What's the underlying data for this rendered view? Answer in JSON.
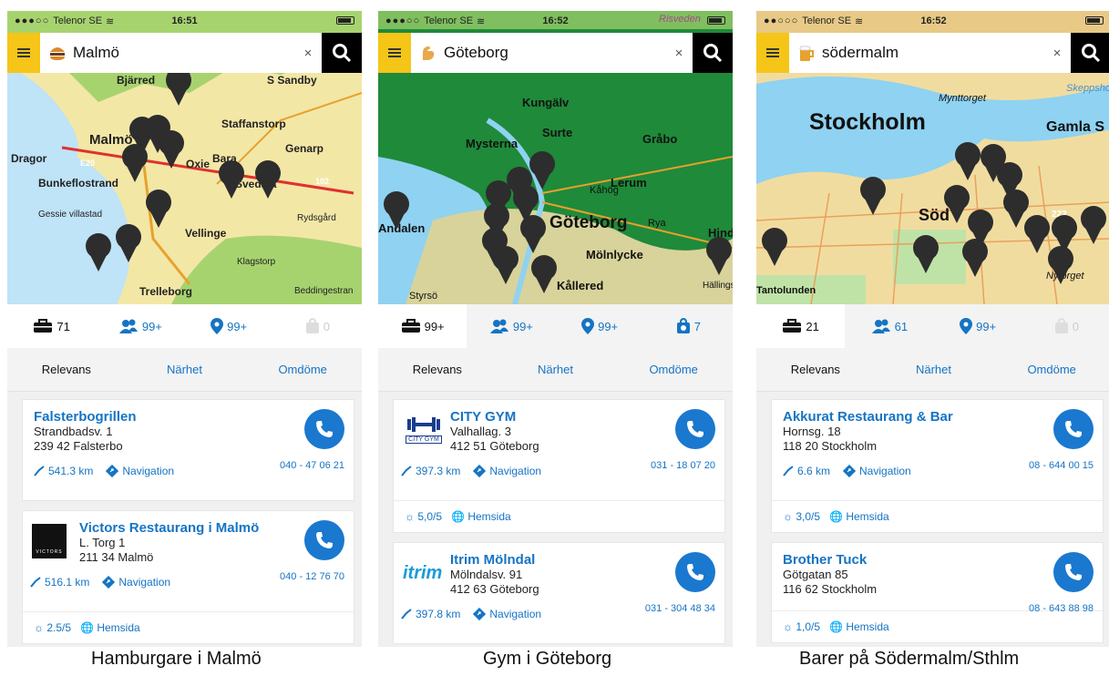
{
  "colors": {
    "accent": "#1574c4",
    "menu_yellow": "#f5c518",
    "call_blue": "#1a78cf"
  },
  "screens": [
    {
      "status": {
        "carrier": "Telenor SE",
        "time": "16:51"
      },
      "search": {
        "category_icon": "burger-icon",
        "query": "Malmö",
        "clear": "×"
      },
      "map": {
        "labels": [
          "Bjärred",
          "S Sandby",
          "Staffanstorp",
          "Malmö",
          "Genarp",
          "Dragor",
          "E20",
          "Bara",
          "Bunkeflostrand",
          "Oxie",
          "Svedala",
          "Gessie villastad",
          "Vellinge",
          "Rydsgård",
          "Klagstorp",
          "Trelleborg",
          "Beddingestran",
          "102"
        ]
      },
      "tabs": [
        "71",
        "99+",
        "99+",
        "0"
      ],
      "sort": [
        "Relevans",
        "Närhet",
        "Omdöme"
      ],
      "cards": [
        {
          "name": "Falsterbogrillen",
          "street": "Strandbadsv. 1",
          "city": "239 42 Falsterbo",
          "phone": "040 - 47 06 21",
          "distance": "541.3 km",
          "nav": "Navigation"
        },
        {
          "name": "Victors Restaurang i Malmö",
          "street": "L. Torg 1",
          "city": "211 34 Malmö",
          "phone": "040 - 12 76 70",
          "distance": "516.1 km",
          "nav": "Navigation",
          "logo": "VICTORS",
          "rating": "2.5/5",
          "web": "Hemsida"
        }
      ],
      "caption": "Hamburgare i Malmö"
    },
    {
      "status": {
        "carrier": "Telenor SE",
        "time": "16:52"
      },
      "search": {
        "category_icon": "flex-arm-icon",
        "query": "Göteborg",
        "clear": "×"
      },
      "map": {
        "labels": [
          "Kungälv",
          "Surte",
          "Mysterna",
          "Gråbo",
          "Lerum",
          "Kåhög",
          "Göteborg",
          "Rya",
          "Mölnlycke",
          "Hind",
          "Kållered",
          "Styrsö",
          "Hällings",
          "Andalen",
          "Risveden"
        ]
      },
      "tabs": [
        "99+",
        "99+",
        "99+",
        "7"
      ],
      "sort": [
        "Relevans",
        "Närhet",
        "Omdöme"
      ],
      "cards": [
        {
          "name": "CITY GYM",
          "street": "Valhallag. 3",
          "city": "412 51 Göteborg",
          "phone": "031 - 18 07 20",
          "distance": "397.3 km",
          "nav": "Navigation",
          "logo": "CITY GYM",
          "rating": "5,0/5",
          "web": "Hemsida"
        },
        {
          "name": "Itrim Mölndal",
          "street": "Mölndalsv. 91",
          "city": "412 63 Göteborg",
          "phone": "031 - 304 48 34",
          "distance": "397.8 km",
          "nav": "Navigation",
          "logo": "itrim"
        }
      ],
      "caption": "Gym i Göteborg"
    },
    {
      "status": {
        "carrier": "Telenor SE",
        "time": "16:52"
      },
      "search": {
        "category_icon": "beer-icon",
        "query": "södermalm",
        "clear": "×"
      },
      "map": {
        "labels": [
          "Stockholm",
          "Gamla S",
          "Mynttorget",
          "Skeppsho",
          "Söd",
          "Tantolunden",
          "Nytorget",
          "222"
        ]
      },
      "tabs": [
        "21",
        "61",
        "99+",
        "0"
      ],
      "sort": [
        "Relevans",
        "Närhet",
        "Omdöme"
      ],
      "cards": [
        {
          "name": "Akkurat Restaurang & Bar",
          "street": "Hornsg. 18",
          "city": "118 20 Stockholm",
          "phone": "08 - 644 00 15",
          "distance": "6.6 km",
          "nav": "Navigation",
          "rating": "3,0/5",
          "web": "Hemsida"
        },
        {
          "name": "Brother Tuck",
          "street": "Götgatan 85",
          "city": "116 62 Stockholm",
          "phone": "08 - 643 88 98",
          "rating": "1,0/5",
          "web": "Hemsida"
        }
      ],
      "caption": "Barer på Södermalm/Sthlm"
    }
  ]
}
